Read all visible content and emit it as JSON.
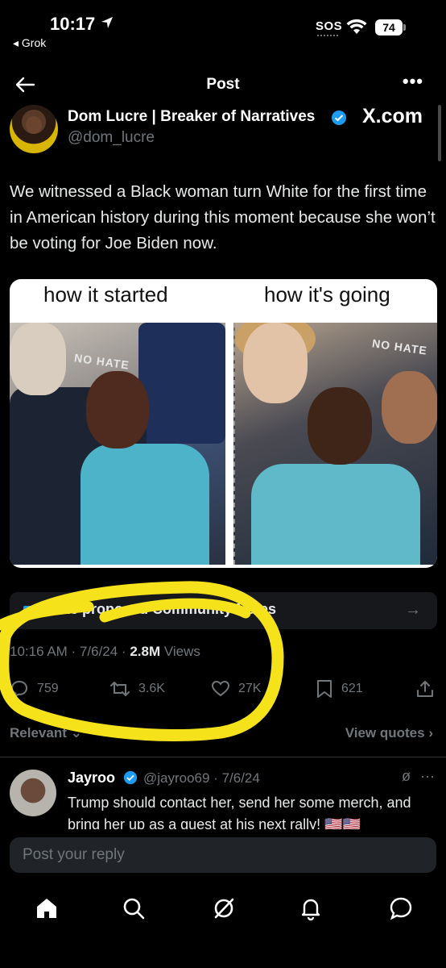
{
  "status": {
    "time": "10:17",
    "back_app": "Grok",
    "sos": "SOS",
    "battery": "74"
  },
  "header": {
    "title": "Post"
  },
  "author": {
    "name": "Dom Lucre | Breaker of Narratives",
    "handle": "@dom_lucre",
    "watermark": "X.com"
  },
  "tweet": {
    "text": "We witnessed a Black woman turn White for the first time in American history during this moment because she won’t be voting for Joe Biden now."
  },
  "media": {
    "caption_left": "how it started",
    "caption_right": "how it's going",
    "sign_left": "NO HATE",
    "sign_right": "NO HATE"
  },
  "community": {
    "label": "Rate proposed Community Notes"
  },
  "meta": {
    "time": "10:16 AM",
    "date": "7/6/24",
    "views_count": "2.8M",
    "views_label": "Views"
  },
  "actions": {
    "replies": "759",
    "reposts": "3.6K",
    "likes": "27K",
    "bookmarks": "621"
  },
  "tabs": {
    "relevant": "Relevant",
    "view_quotes": "View quotes"
  },
  "reply": {
    "name": "Jayroo",
    "handle": "@jayroo69",
    "date": "7/6/24",
    "text": "Trump should contact her, send her some merch, and bring her up as a guest at his next rally! 🇺🇸🇺🇸"
  },
  "compose": {
    "placeholder": "Post your reply"
  },
  "colors": {
    "accent": "#1d9bf0",
    "highlight": "#f5e21b",
    "muted": "#71767b",
    "background": "#000000"
  }
}
